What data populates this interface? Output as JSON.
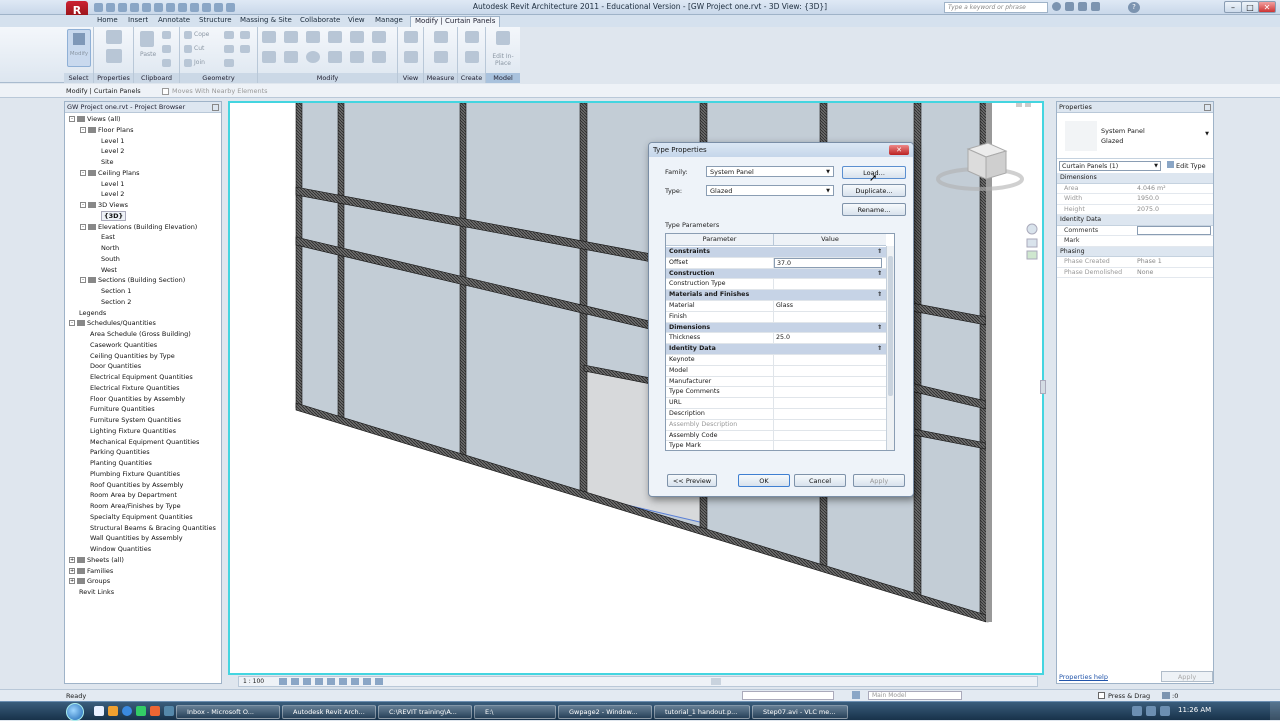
{
  "window": {
    "title": "Autodesk Revit Architecture 2011 - Educational Version - [GW Project one.rvt - 3D View: {3D}]",
    "search_placeholder": "Type a keyword or phrase"
  },
  "ribbon": {
    "tabs": [
      "Home",
      "Insert",
      "Annotate",
      "Structure",
      "Massing & Site",
      "Collaborate",
      "View",
      "Manage"
    ],
    "active_tab": "Modify | Curtain Panels",
    "groups": {
      "select": "Select",
      "properties": "Properties",
      "clipboard": "Clipboard",
      "geometry": "Geometry",
      "modify": "Modify",
      "view": "View",
      "measure": "Measure",
      "create": "Create",
      "model": "Model"
    },
    "modify_btn": "Modify",
    "paste": "Paste",
    "cope": "Cope",
    "cut": "Cut",
    "join": "Join",
    "edit_inplace": "Edit In-Place"
  },
  "optionsbar": {
    "context": "Modify | Curtain Panels",
    "moves_label": "Moves With Nearby Elements"
  },
  "browser": {
    "title": "GW Project one.rvt - Project Browser",
    "items": [
      {
        "label": "Views (all)",
        "level": 0,
        "exp": "-"
      },
      {
        "label": "Floor Plans",
        "level": 1,
        "exp": "-"
      },
      {
        "label": "Level 1",
        "level": 2
      },
      {
        "label": "Level 2",
        "level": 2
      },
      {
        "label": "Site",
        "level": 2
      },
      {
        "label": "Ceiling Plans",
        "level": 1,
        "exp": "-"
      },
      {
        "label": "Level 1",
        "level": 2
      },
      {
        "label": "Level 2",
        "level": 2
      },
      {
        "label": "3D Views",
        "level": 1,
        "exp": "-"
      },
      {
        "label": "{3D}",
        "level": 2,
        "bold": true
      },
      {
        "label": "Elevations (Building Elevation)",
        "level": 1,
        "exp": "-"
      },
      {
        "label": "East",
        "level": 2
      },
      {
        "label": "North",
        "level": 2
      },
      {
        "label": "South",
        "level": 2
      },
      {
        "label": "West",
        "level": 2
      },
      {
        "label": "Sections (Building Section)",
        "level": 1,
        "exp": "-"
      },
      {
        "label": "Section 1",
        "level": 2
      },
      {
        "label": "Section 2",
        "level": 2
      },
      {
        "label": "Legends",
        "level": 0
      },
      {
        "label": "Schedules/Quantities",
        "level": 0,
        "exp": "-"
      },
      {
        "label": "Area Schedule (Gross Building)",
        "level": 1
      },
      {
        "label": "Casework Quantities",
        "level": 1
      },
      {
        "label": "Ceiling Quantities by Type",
        "level": 1
      },
      {
        "label": "Door Quantities",
        "level": 1
      },
      {
        "label": "Electrical Equipment Quantities",
        "level": 1
      },
      {
        "label": "Electrical Fixture Quantities",
        "level": 1
      },
      {
        "label": "Floor Quantities by Assembly",
        "level": 1
      },
      {
        "label": "Furniture Quantities",
        "level": 1
      },
      {
        "label": "Furniture System Quantities",
        "level": 1
      },
      {
        "label": "Lighting Fixture Quantities",
        "level": 1
      },
      {
        "label": "Mechanical Equipment Quantities",
        "level": 1
      },
      {
        "label": "Parking Quantities",
        "level": 1
      },
      {
        "label": "Planting Quantities",
        "level": 1
      },
      {
        "label": "Plumbing Fixture Quantities",
        "level": 1
      },
      {
        "label": "Roof Quantities by Assembly",
        "level": 1
      },
      {
        "label": "Room Area by Department",
        "level": 1
      },
      {
        "label": "Room Area/Finishes by Type",
        "level": 1
      },
      {
        "label": "Specialty Equipment Quantities",
        "level": 1
      },
      {
        "label": "Structural Beams & Bracing Quantities",
        "level": 1
      },
      {
        "label": "Wall Quantities by Assembly",
        "level": 1
      },
      {
        "label": "Window Quantities",
        "level": 1
      },
      {
        "label": "Sheets (all)",
        "level": 0,
        "exp": "+"
      },
      {
        "label": "Families",
        "level": 0,
        "exp": "+"
      },
      {
        "label": "Groups",
        "level": 0,
        "exp": "+"
      },
      {
        "label": "Revit Links",
        "level": 0
      }
    ]
  },
  "dialog": {
    "title": "Type Properties",
    "family_label": "Family:",
    "family_value": "System Panel",
    "type_label": "Type:",
    "type_value": "Glazed",
    "load": "Load...",
    "duplicate": "Duplicate...",
    "rename": "Rename...",
    "type_params": "Type Parameters",
    "col_param": "Parameter",
    "col_value": "Value",
    "rows": [
      {
        "k": "Constraints",
        "sec": true
      },
      {
        "k": "Offset",
        "v": "37.0"
      },
      {
        "k": "Construction",
        "sec": true
      },
      {
        "k": "Construction Type",
        "v": ""
      },
      {
        "k": "Materials and Finishes",
        "sec": true
      },
      {
        "k": "Material",
        "v": "Glass"
      },
      {
        "k": "Finish",
        "v": ""
      },
      {
        "k": "Dimensions",
        "sec": true
      },
      {
        "k": "Thickness",
        "v": "25.0"
      },
      {
        "k": "Identity Data",
        "sec": true
      },
      {
        "k": "Keynote",
        "v": ""
      },
      {
        "k": "Model",
        "v": ""
      },
      {
        "k": "Manufacturer",
        "v": ""
      },
      {
        "k": "Type Comments",
        "v": ""
      },
      {
        "k": "URL",
        "v": ""
      },
      {
        "k": "Description",
        "v": ""
      },
      {
        "k": "Assembly Description",
        "v": "",
        "grey": true
      },
      {
        "k": "Assembly Code",
        "v": ""
      },
      {
        "k": "Type Mark",
        "v": ""
      }
    ],
    "preview": "<< Preview",
    "ok": "OK",
    "cancel": "Cancel",
    "apply": "Apply"
  },
  "properties": {
    "title": "Properties",
    "family": "System Panel",
    "type": "Glazed",
    "selector": "Curtain Panels (1)",
    "edit_type": "Edit Type",
    "sections": [
      {
        "name": "Dimensions",
        "rows": [
          {
            "k": "Area",
            "v": "4.046 m²",
            "grey": true
          },
          {
            "k": "Width",
            "v": "1950.0",
            "grey": true
          },
          {
            "k": "Height",
            "v": "2075.0",
            "grey": true
          }
        ]
      },
      {
        "name": "Identity Data",
        "rows": [
          {
            "k": "Comments",
            "v": ""
          },
          {
            "k": "Mark",
            "v": ""
          }
        ]
      },
      {
        "name": "Phasing",
        "rows": [
          {
            "k": "Phase Created",
            "v": "Phase 1",
            "grey": true
          },
          {
            "k": "Phase Demolished",
            "v": "None",
            "grey": true
          }
        ]
      }
    ],
    "help": "Properties help",
    "apply": "Apply"
  },
  "viewbar": {
    "scale": "1 : 100"
  },
  "status": {
    "ready": "Ready",
    "model": "Main Model",
    "press_drag": "Press & Drag",
    "filter_count": ":0"
  },
  "taskbar": {
    "items": [
      "Inbox - Microsoft O...",
      "Autodesk Revit Arch...",
      "C:\\REVIT training\\A...",
      "E:\\",
      "Gwpage2 - Window...",
      "tutorial_1 handout.p...",
      "Step07.avi - VLC me..."
    ],
    "clock": "11:26 AM"
  }
}
